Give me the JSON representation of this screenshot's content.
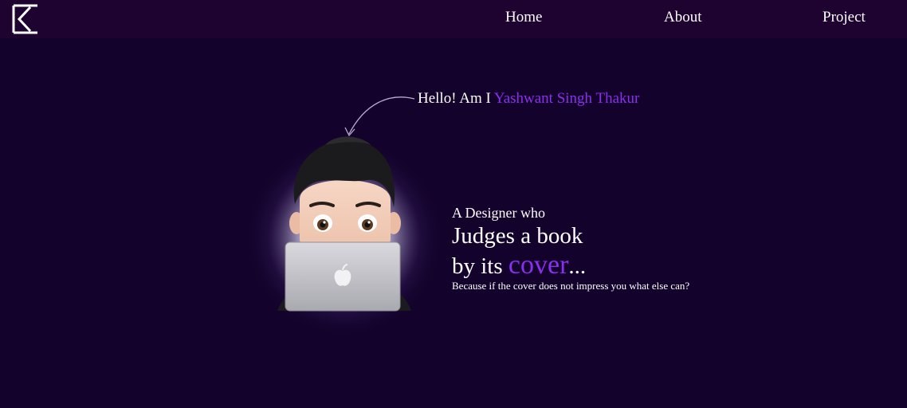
{
  "nav": {
    "logo_icon": "logo-icon",
    "links": [
      {
        "label": "Home"
      },
      {
        "label": "About"
      },
      {
        "label": "Project"
      }
    ]
  },
  "hero": {
    "greeting_prefix": "Hello! Am I",
    "name": "Yashwant Singh Thakur",
    "line1": "A Designer who",
    "line2": "Judges a book",
    "line3_prefix": "by its",
    "line3_highlight": "cover",
    "line3_suffix": "...",
    "subline": "Because if the cover does not impress you what else can?",
    "avatar_icon": "memoji-laptop-avatar",
    "arrow_icon": "curved-arrow-icon"
  },
  "colors": {
    "background": "#13022b",
    "navbar": "#1e0330",
    "accent": "#8b2ff0",
    "text": "#ffffff"
  }
}
